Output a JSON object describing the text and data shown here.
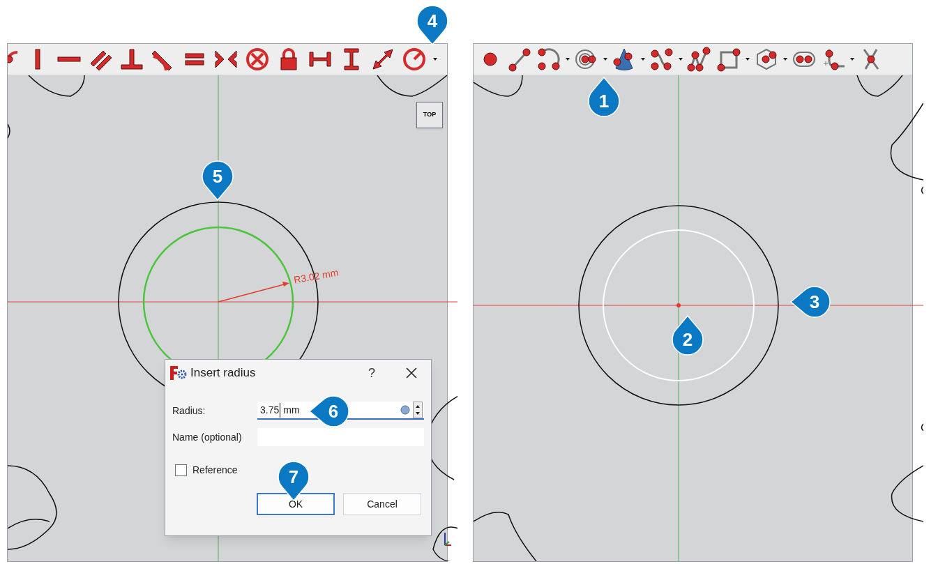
{
  "left_view": {
    "view_cube": "TOP",
    "dimension_label": "R3.02 mm"
  },
  "dialog": {
    "title": "Insert radius",
    "help": "?",
    "fields": [
      {
        "label": "Radius:",
        "value": "3.75",
        "unit": "mm",
        "focused": true
      },
      {
        "label": "Name (optional)",
        "focused": false
      }
    ],
    "checkbox": {
      "label": "Reference",
      "checked": false
    },
    "buttons": [
      {
        "label": "OK",
        "default": true
      },
      {
        "label": "Cancel",
        "default": false
      }
    ]
  },
  "callouts": [
    {
      "number": "4",
      "kind": "down"
    },
    {
      "number": "1",
      "kind": "up"
    },
    {
      "number": "5",
      "kind": "down"
    },
    {
      "number": "3",
      "kind": "left"
    },
    {
      "number": "2",
      "kind": "up"
    },
    {
      "number": "6",
      "kind": "left"
    },
    {
      "number": "7",
      "kind": "down"
    }
  ]
}
